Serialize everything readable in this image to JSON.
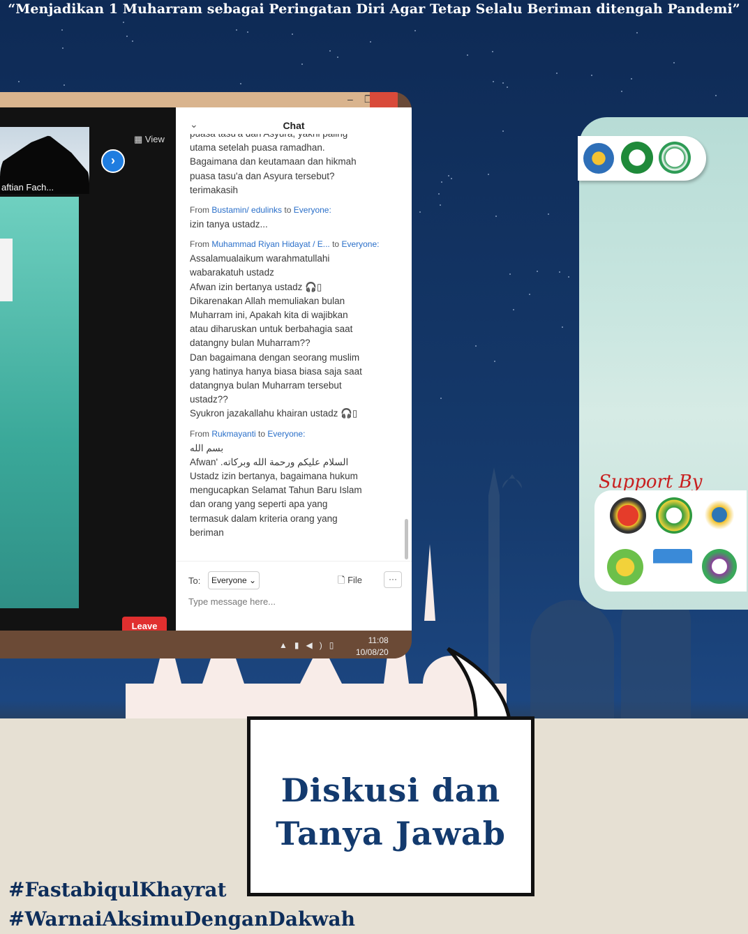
{
  "header": {
    "quote": "“Menjadikan 1 Muharram sebagai Peringatan Diri Agar Tetap Selalu Beriman ditengah Pandemi”"
  },
  "zoom": {
    "participant_name": "aftian Fach...",
    "view_label": "View",
    "leave_label": "Leave",
    "chat": {
      "title": "Chat",
      "messages": [
        {
          "from": "",
          "to": "",
          "lines": [
            "puasa tasu'a dan Asyura, yakni paling",
            "utama setelah puasa ramadhan.",
            "Bagaimana dan keutamaan dan hikmah",
            "puasa tasu'a dan Asyura tersebut?",
            "terimakasih"
          ]
        },
        {
          "from": "Bustamin/ edulinks",
          "to": "Everyone:",
          "lines": [
            "izin tanya ustadz..."
          ]
        },
        {
          "from": "Muhammad Riyan Hidayat / E...",
          "to": "Everyone:",
          "lines": [
            "Assalamualaikum warahmatullahi",
            "wabarakatuh ustadz",
            "Afwan izin bertanya ustadz 🎧▯",
            "Dikarenakan Allah memuliakan bulan",
            "Muharram ini, Apakah kita di wajibkan",
            "atau diharuskan untuk berbahagia saat",
            "datangny bulan Muharram??",
            "Dan bagaimana dengan seorang muslim",
            "yang hatinya hanya biasa biasa saja saat",
            "datangnya bulan Muharram tersebut",
            "ustadz??",
            "Syukron jazakallahu khairan ustadz 🎧▯"
          ]
        },
        {
          "from": "Rukmayanti",
          "to": "Everyone:",
          "lines": [
            "بسم الله",
            "السلام عليكم ورحمة الله وبركاته. 'Afwan",
            "Ustadz izin bertanya, bagaimana hukum",
            "mengucapkan Selamat Tahun Baru Islam",
            "dan orang yang seperti apa yang",
            "termasuk dalam kriteria orang yang",
            "beriman"
          ]
        }
      ],
      "from_word": "From",
      "to_word": "to",
      "to_label": "To:",
      "recipient": "Everyone",
      "file_label": "File",
      "more_label": "···",
      "input_placeholder": "Type message here..."
    },
    "taskbar": {
      "time": "11:08",
      "date": "10/08/20"
    }
  },
  "right_panel": {
    "support_title": "Support By"
  },
  "bubble": {
    "line1": "Diskusi dan",
    "line2": "Tanya Jawab"
  },
  "hashtags": [
    "#FastabiqulKhayrat",
    "#WarnaiAksimuDenganDakwah"
  ],
  "colors": {
    "sky": "#0e2a55",
    "chat_link": "#2a6fc9",
    "leave": "#e02f2f",
    "support": "#c81f1f",
    "title_blue": "#133a6e"
  }
}
